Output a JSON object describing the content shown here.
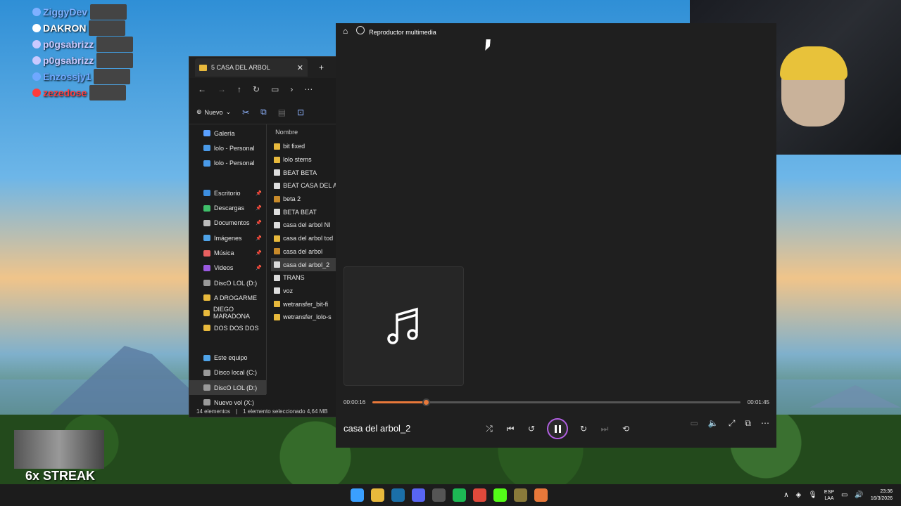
{
  "chat": [
    {
      "name": "ZiggyDev",
      "color": "#7fb0ff"
    },
    {
      "name": "DAKRON",
      "color": "#ffffff"
    },
    {
      "name": "p0gsabrizz",
      "color": "#c9c9ff"
    },
    {
      "name": "p0gsabrizz",
      "color": "#c9c9ff"
    },
    {
      "name": "Enzossjy1",
      "color": "#6fa8ff"
    },
    {
      "name": "zezedose",
      "color": "#ff3b3b"
    }
  ],
  "streak": {
    "label": "6x STREAK"
  },
  "explorer": {
    "tab_title": "5 CASA DEL ARBOL",
    "new_label": "Nuevo",
    "column_name": "Nombre",
    "sidebar": [
      {
        "label": "Galería",
        "color": "#5aa0ff",
        "pinned": false
      },
      {
        "label": "lolo - Personal",
        "color": "#4a9ae8",
        "pinned": false
      },
      {
        "label": "lolo - Personal",
        "color": "#4a9ae8",
        "pinned": false
      },
      {
        "label": "",
        "color": "",
        "pinned": false
      },
      {
        "label": "Escritorio",
        "color": "#3d8ee0",
        "pinned": true
      },
      {
        "label": "Descargas",
        "color": "#3fbf6a",
        "pinned": true
      },
      {
        "label": "Documentos",
        "color": "#bcbcbc",
        "pinned": true
      },
      {
        "label": "Imágenes",
        "color": "#4fa3e8",
        "pinned": true
      },
      {
        "label": "Música",
        "color": "#e86060",
        "pinned": true
      },
      {
        "label": "Videos",
        "color": "#9a5ae0",
        "pinned": true
      },
      {
        "label": "DiscO LOL (D:)",
        "color": "#9a9a9a",
        "pinned": false
      },
      {
        "label": "A DROGARME",
        "color": "#e8b93c",
        "pinned": false
      },
      {
        "label": "DIEGO MARADONA",
        "color": "#e8b93c",
        "pinned": false
      },
      {
        "label": "DOS DOS DOS",
        "color": "#e8b93c",
        "pinned": false
      },
      {
        "label": "",
        "color": "",
        "pinned": false
      },
      {
        "label": "Este equipo",
        "color": "#4fa3e8",
        "pinned": false
      },
      {
        "label": "Disco local (C:)",
        "color": "#9a9a9a",
        "pinned": false
      },
      {
        "label": "DiscO LOL (D:)",
        "color": "#9a9a9a",
        "pinned": false
      },
      {
        "label": "Nuevo vol (X:)",
        "color": "#9a9a9a",
        "pinned": false
      }
    ],
    "files": [
      {
        "name": "bit fixed",
        "kind": "folder"
      },
      {
        "name": "lolo stems",
        "kind": "folder"
      },
      {
        "name": "BEAT BETA",
        "kind": "audio"
      },
      {
        "name": "BEAT CASA DEL A",
        "kind": "audio"
      },
      {
        "name": "beta 2",
        "kind": "project"
      },
      {
        "name": "BETA BEAT",
        "kind": "audio"
      },
      {
        "name": "casa del arbol NI",
        "kind": "audio"
      },
      {
        "name": "casa del arbol tod",
        "kind": "folder"
      },
      {
        "name": "casa del arbol",
        "kind": "project"
      },
      {
        "name": "casa del arbol_2",
        "kind": "audio"
      },
      {
        "name": "TRANS",
        "kind": "audio"
      },
      {
        "name": "voz",
        "kind": "audio"
      },
      {
        "name": "wetransfer_bit-fi",
        "kind": "folder"
      },
      {
        "name": "wetransfer_lolo-s",
        "kind": "folder"
      }
    ],
    "status_count": "14 elementos",
    "status_selected": "1 elemento seleccionado  4,64 MB"
  },
  "player": {
    "app_title": "Reproductor multimedia",
    "track_title": "casa del arbol_2",
    "current_time": "00:00:16",
    "total_time": "00:01:45",
    "progress_fraction": 0.145,
    "accent": "#e8783a"
  },
  "taskbar": {
    "lang_top": "ESP",
    "lang_bottom": "LAA",
    "time": "23:36",
    "date": "16/3/2026",
    "apps": [
      {
        "name": "start-icon",
        "color": "#3aa0ff"
      },
      {
        "name": "file-explorer-icon",
        "color": "#e8b93c"
      },
      {
        "name": "steam-icon",
        "color": "#1b6fa8"
      },
      {
        "name": "discord-icon",
        "color": "#5865f2"
      },
      {
        "name": "obs-icon",
        "color": "#555555"
      },
      {
        "name": "spotify-icon",
        "color": "#1db954"
      },
      {
        "name": "chrome-icon",
        "color": "#e0493b"
      },
      {
        "name": "kick-icon",
        "color": "#53fc18"
      },
      {
        "name": "fl-studio-icon",
        "color": "#8a7a3a"
      },
      {
        "name": "media-player-icon",
        "color": "#e8783a"
      }
    ]
  }
}
